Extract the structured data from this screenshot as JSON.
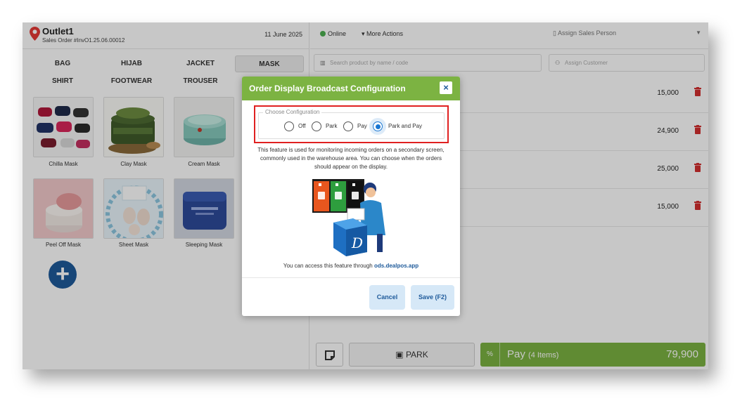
{
  "header": {
    "outlet": "Outlet1",
    "order": "Sales Order #InvO1.25.06.00012",
    "date": "11 June 2025"
  },
  "categories": [
    "BAG",
    "HIJAB",
    "JACKET",
    "MASK",
    "SHIRT",
    "FOOTWEAR",
    "TROUSER"
  ],
  "active_category": "MASK",
  "products": [
    "Chilla Mask",
    "Clay Mask",
    "Cream Mask",
    "Peel Off Mask",
    "Sheet Mask",
    "Sleeping Mask"
  ],
  "right": {
    "status": "Online",
    "more_actions": "More Actions",
    "assign_sales": "Assign Sales Person",
    "search_placeholder": "Search product by name / code",
    "customer_placeholder": "Assign Customer",
    "lines": [
      {
        "price": "15,000"
      },
      {
        "price": "24,900"
      },
      {
        "price": "25,000"
      },
      {
        "price": "15,000"
      }
    ],
    "park": "PARK",
    "pay_pct": "%",
    "pay_label": "Pay",
    "pay_items": "(4 Items)",
    "pay_total": "79,900"
  },
  "modal": {
    "title": "Order Display Broadcast Configuration",
    "close": "×",
    "legend": "Choose Configuration",
    "options": [
      "Off",
      "Park",
      "Pay",
      "Park and Pay"
    ],
    "selected": "Park and Pay",
    "description": "This feature is used for monitoring incoming orders on a secondary screen, commonly used in the warehouse area. You can choose when the orders should appear on the display.",
    "access_text": "You can access this feature through",
    "access_link": "ods.dealpos.app",
    "cancel": "Cancel",
    "save": "Save (F2)"
  },
  "colors": {
    "accent_green": "#7cb342",
    "brand_blue": "#1e5a9a",
    "danger_red": "#e02020",
    "radio_blue": "#1976d2"
  }
}
